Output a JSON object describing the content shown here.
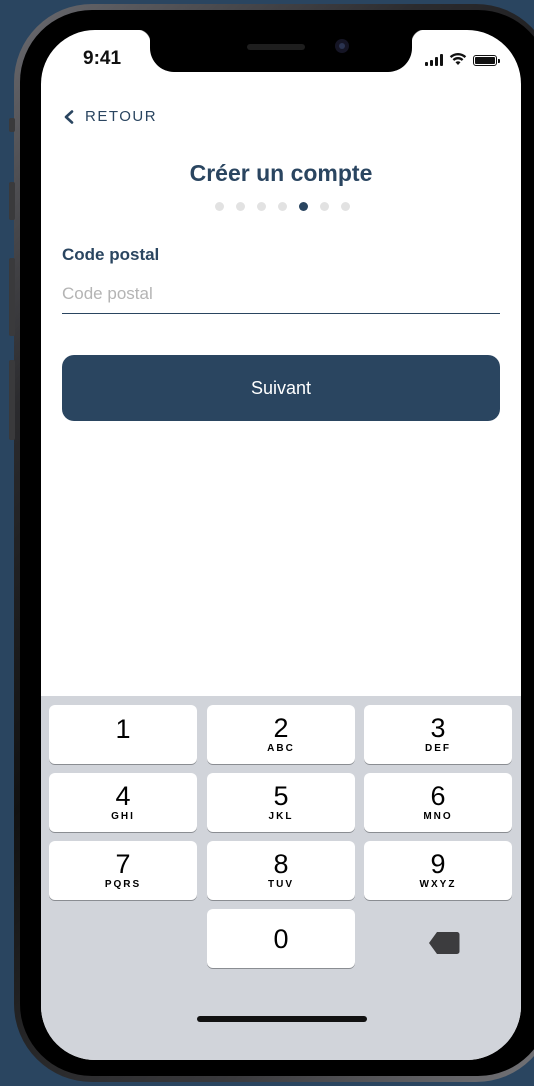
{
  "status_bar": {
    "time": "9:41"
  },
  "header": {
    "back_label": "RETOUR",
    "title": "Créer un compte"
  },
  "progress": {
    "total_steps": 7,
    "current_step": 5
  },
  "form": {
    "field_label": "Code postal",
    "field_placeholder": "Code postal",
    "field_value": ""
  },
  "actions": {
    "next_label": "Suivant"
  },
  "keyboard": {
    "keys": [
      {
        "digit": "1",
        "letters": ""
      },
      {
        "digit": "2",
        "letters": "ABC"
      },
      {
        "digit": "3",
        "letters": "DEF"
      },
      {
        "digit": "4",
        "letters": "GHI"
      },
      {
        "digit": "5",
        "letters": "JKL"
      },
      {
        "digit": "6",
        "letters": "MNO"
      },
      {
        "digit": "7",
        "letters": "PQRS"
      },
      {
        "digit": "8",
        "letters": "TUV"
      },
      {
        "digit": "9",
        "letters": "WXYZ"
      },
      {
        "digit": "0",
        "letters": ""
      }
    ]
  },
  "colors": {
    "primary": "#2a4560",
    "background": "#2a4560",
    "keyboard_bg": "#d1d4da",
    "dot_inactive": "#e2e2e2",
    "placeholder": "#b4b4b4"
  }
}
